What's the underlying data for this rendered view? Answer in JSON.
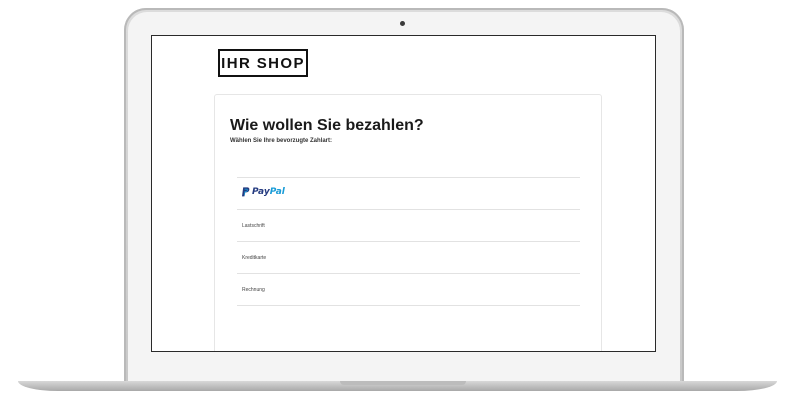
{
  "shop": {
    "logo_text": "IHR SHOP"
  },
  "payment": {
    "title": "Wie wollen Sie bezahlen?",
    "subtitle": "Wählen Sie Ihre bevorzugte Zahlart:",
    "options": [
      {
        "label_pay": "Pay",
        "label_pal": "Pal",
        "icon": "paypal-logo"
      },
      {
        "label": "Lastschrift"
      },
      {
        "label": "Kreditkarte"
      },
      {
        "label": "Rechnung"
      }
    ]
  },
  "colors": {
    "paypal_dark": "#253b80",
    "paypal_light": "#179bd7",
    "device": "#d0d0d0"
  }
}
